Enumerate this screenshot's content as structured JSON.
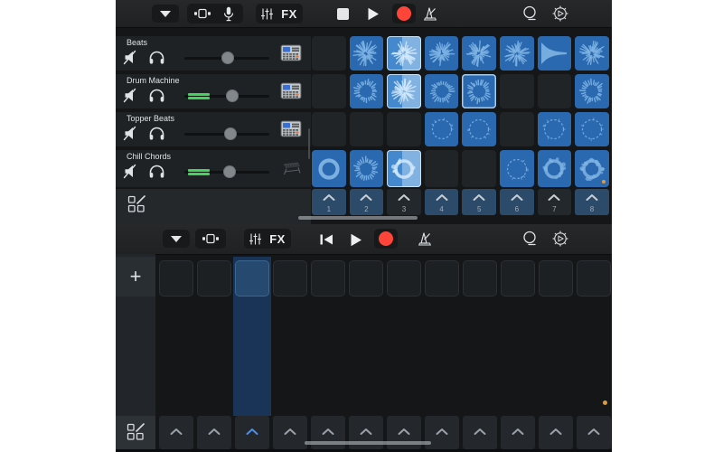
{
  "colors": {
    "accent_blue": "#2a69b0",
    "playing_blue": "#4489cd",
    "glyph_blue": "#7fb4e4",
    "glyph_bright": "#d2e9fb",
    "trigger_blue": "#2c4a69",
    "trigger_dark": "#23282d",
    "active_column": "#1a3457",
    "meter_green": "#46d15f",
    "record_red": "#ff453a",
    "orange_dot": "#e09a3e"
  },
  "icons": [
    "disclosure-triangle",
    "live-loops-view",
    "microphone",
    "mixer-faders",
    "stop",
    "play",
    "record",
    "metronome",
    "loop-browser",
    "settings-gear",
    "rewind-to-start",
    "mute-speaker",
    "headphones",
    "drum-machine",
    "keyboard",
    "cell-edit",
    "chevron-up",
    "plus"
  ],
  "top_shot": {
    "toolbar": {
      "fx_label": "FX"
    },
    "tracks": [
      {
        "name": "Beats",
        "instrument": "drum-machine",
        "meter": false,
        "volume": 0.52
      },
      {
        "name": "Drum Machine",
        "instrument": "drum-machine",
        "meter": true,
        "volume": 0.58
      },
      {
        "name": "Topper Beats",
        "instrument": "drum-machine",
        "meter": false,
        "volume": 0.56
      },
      {
        "name": "Chill Chords",
        "instrument": "keyboard",
        "meter": true,
        "volume": 0.54
      }
    ],
    "grid": {
      "cells": [
        [
          "",
          "burst",
          "burst play",
          "burst",
          "burst",
          "burst",
          "wave",
          "burst"
        ],
        [
          "",
          "ring",
          "burst play",
          "ring",
          "ring sel",
          "",
          "",
          "ring"
        ],
        [
          "",
          "",
          "",
          "circle",
          "circle",
          "",
          "circle",
          "circle"
        ],
        [
          "ringbold",
          "ring",
          "ringfuzzy play",
          "",
          "",
          "circle",
          "ringfuzzy",
          "ringfuzzy dot"
        ]
      ],
      "column_triggers": [
        {
          "label": "1",
          "state": "blue"
        },
        {
          "label": "2",
          "state": "blue"
        },
        {
          "label": "3",
          "state": "dark"
        },
        {
          "label": "4",
          "state": "blue"
        },
        {
          "label": "5",
          "state": "blue"
        },
        {
          "label": "6",
          "state": "blue"
        },
        {
          "label": "7",
          "state": "dark"
        },
        {
          "label": "8",
          "state": "blue"
        }
      ]
    }
  },
  "bottom_shot": {
    "toolbar": {
      "fx_label": "FX"
    },
    "add_track_label": "+",
    "grid": {
      "columns": 12,
      "active_column_index": 2,
      "cells": [
        "",
        "",
        "",
        "",
        "",
        "",
        "",
        "",
        "",
        "",
        "",
        ""
      ],
      "triggers": [
        "gray",
        "gray",
        "blue",
        "gray",
        "gray",
        "gray",
        "gray",
        "gray",
        "gray",
        "gray",
        "gray",
        "gray"
      ]
    }
  }
}
